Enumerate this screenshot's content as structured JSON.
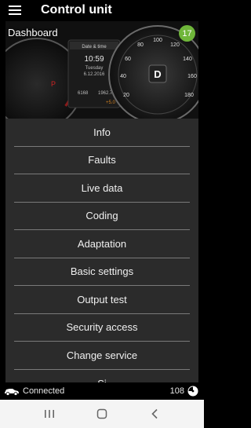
{
  "appbar": {
    "title": "Control unit",
    "menu_icon": "hamburger-menu-icon"
  },
  "hero": {
    "label": "Dashboard",
    "badge": "17",
    "badge_color": "#6fb63a",
    "speedo_ticks": [
      "20",
      "40",
      "60",
      "80",
      "100",
      "120",
      "140",
      "160",
      "180"
    ],
    "gear": "D",
    "gear_left": "P",
    "panel_header": "Date & time",
    "panel_time": "10:59",
    "panel_day": "Tuesday",
    "panel_date": "6.12.2016",
    "odometer": "6168",
    "trip": "1962.7",
    "temp": "+5.0"
  },
  "menu": {
    "items": [
      "Info",
      "Faults",
      "Live data",
      "Coding",
      "Adaptation",
      "Basic settings",
      "Output test",
      "Security access",
      "Change service",
      "Si"
    ]
  },
  "status": {
    "car_icon": "car-icon",
    "text": "Connected",
    "count": "108",
    "gauge_icon": "gauge-icon"
  },
  "navbar": {
    "recent_icon": "recent-apps-icon",
    "home_icon": "home-icon",
    "back_icon": "back-icon"
  }
}
